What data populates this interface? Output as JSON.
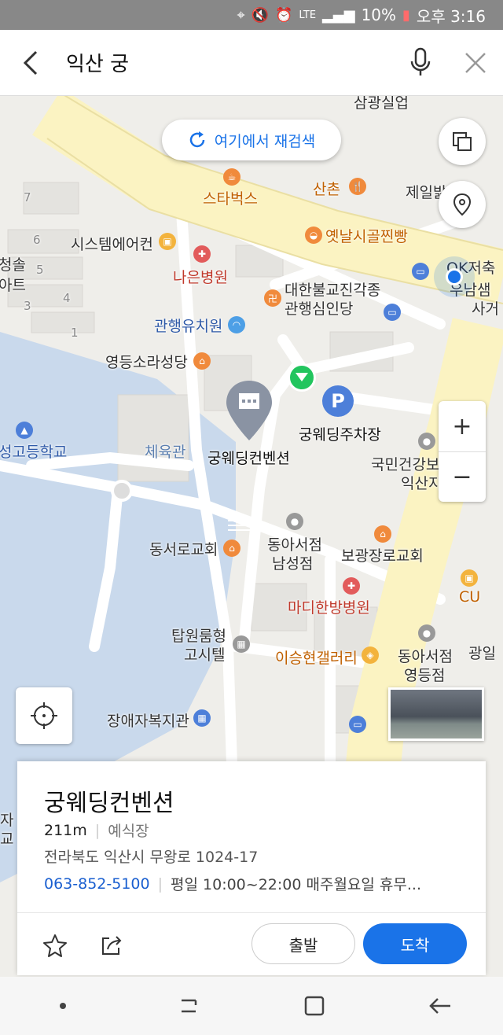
{
  "status_bar": {
    "network": "LTE",
    "battery": "10%",
    "time": "오후 3:16"
  },
  "search": {
    "query": "익산 궁"
  },
  "map": {
    "research_button": "여기에서 재검색",
    "labels": {
      "samgwang": "삼광실업",
      "starbucks": "스타벅스",
      "sanchon": "산촌",
      "jeil": "제일밝",
      "system_aircon": "시스템에어컨",
      "yetnal": "옛날시골찐빵",
      "naeun": "나은병원",
      "ok_savings": "OK저축",
      "daehan_line1": "대한불교진각종",
      "daehan_line2": "관행심인당",
      "unam_line1": "우남샘",
      "unam_line2": "사거",
      "cheongsol_line1": "청솔",
      "cheongsol_line2": "아트",
      "kindergarten": "관행유치원",
      "yeongdeung_church": "영등소라성당",
      "gungwedding_convention": "궁웨딩컨벤션",
      "gungwedding_parking": "궁웨딩주차장",
      "insurance_line1": "국민건강보",
      "insurance_line2": "익산지",
      "highschool": "성고등학교",
      "gym": "체육관",
      "dongseoro_church": "동서로교회",
      "donga_namseong_line1": "동아서점",
      "donga_namseong_line2": "남성점",
      "bogwangjang_church": "보광장로교회",
      "madi_hospital": "마디한방병원",
      "cu": "CU",
      "tapwon_line1": "탑원룸형",
      "tapwon_line2": "고시텔",
      "gallery": "이승현갤러리",
      "donga_yeongdeung_line1": "동아서점",
      "donga_yeongdeung_line2": "영등점",
      "gwangil": "광일",
      "disabled_welfare": "장애자복지관",
      "left_edge_1": "자",
      "left_edge_2": "교"
    },
    "block_numbers": [
      "7",
      "6",
      "5",
      "4",
      "3",
      "1"
    ],
    "zoom_in": "+",
    "zoom_out": "−"
  },
  "place_card": {
    "name": "궁웨딩컨벤션",
    "distance": "211m",
    "category": "예식장",
    "address": "전라북도 익산시 무왕로 1024-17",
    "phone": "063-852-5100",
    "hours": "평일 10:00~22:00 매주월요일 휴무...",
    "depart_button": "출발",
    "arrive_button": "도착"
  },
  "colors": {
    "accent": "#1a73e8",
    "major_road": "#fbf3c2",
    "water": "#c9d9ec",
    "marker": "#8a93a3",
    "green_marker": "#22c55e"
  }
}
